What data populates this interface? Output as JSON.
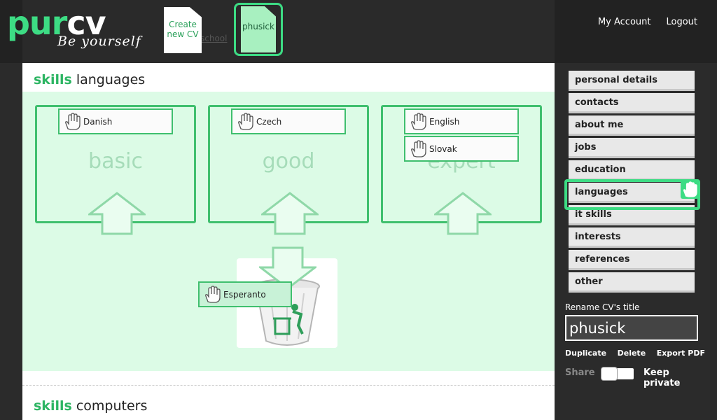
{
  "header": {
    "logo_pur": "pur",
    "logo_cv": "cv",
    "tagline": "Be yourself",
    "create_cv_label": "Create new CV",
    "current_cv_label": "phusick",
    "ghost_link_1": "",
    "ghost_link_2": "school",
    "my_account": "My Account",
    "logout": "Logout"
  },
  "main": {
    "languages_section": {
      "title_bold": "skills",
      "title_rest": "languages",
      "levels": [
        {
          "label": "basic",
          "languages": [
            "Danish"
          ]
        },
        {
          "label": "good",
          "languages": [
            "Czech"
          ]
        },
        {
          "label": "expert",
          "languages": [
            "English",
            "Slovak"
          ]
        }
      ],
      "dragging": "Esperanto"
    },
    "computers_section": {
      "title_bold": "skills",
      "title_rest": "computers"
    }
  },
  "sidebar": {
    "items": [
      {
        "label": "personal details"
      },
      {
        "label": "contacts"
      },
      {
        "label": "about me"
      },
      {
        "label": "jobs"
      },
      {
        "label": "education"
      },
      {
        "label": "languages"
      },
      {
        "label": "it skills"
      },
      {
        "label": "interests"
      },
      {
        "label": "references"
      },
      {
        "label": "other"
      }
    ],
    "selected_item": "languages",
    "rename_label": "Rename CV's title",
    "rename_value": "phusick",
    "duplicate": "Duplicate",
    "delete": "Delete",
    "export_pdf": "Export PDF",
    "share": "Share",
    "keep_private": "Keep private"
  },
  "colors": {
    "accent": "#3ddc84",
    "section_bg": "#dcfbe6",
    "border_green": "#3fbf6e",
    "sidebar_bg": "#2b2b2b"
  }
}
